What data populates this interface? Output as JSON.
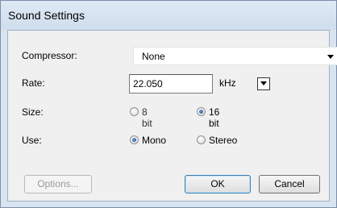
{
  "window": {
    "title": "Sound Settings"
  },
  "compressor": {
    "label": "Compressor:",
    "value": "None"
  },
  "rate": {
    "label": "Rate:",
    "value": "22.050",
    "unit": "kHz"
  },
  "size": {
    "label": "Size:",
    "options": [
      "8 bit",
      "16 bit"
    ],
    "selected": "16 bit"
  },
  "use": {
    "label": "Use:",
    "options": [
      "Mono",
      "Stereo"
    ],
    "selected": "Mono"
  },
  "buttons": {
    "options": "Options...",
    "ok": "OK",
    "cancel": "Cancel"
  }
}
